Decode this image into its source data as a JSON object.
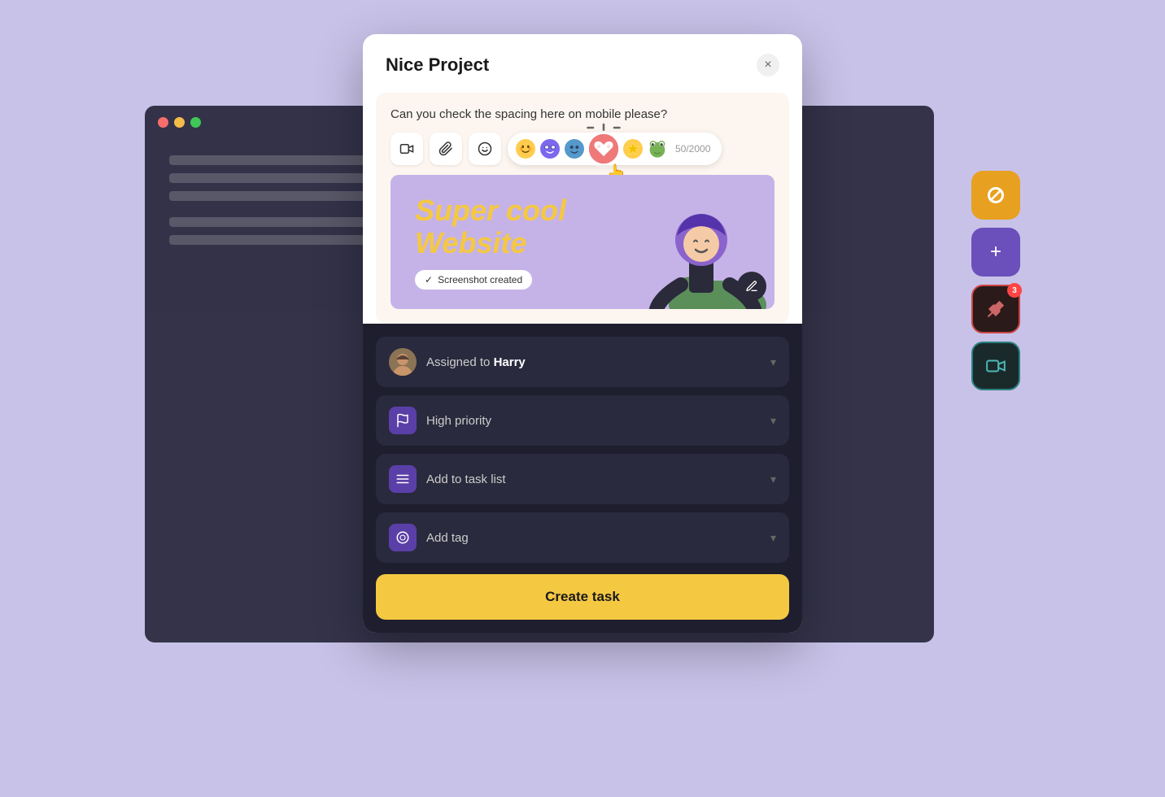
{
  "background": {
    "color": "#c8c2e8"
  },
  "bg_window": {
    "traffic_lights": [
      "red",
      "yellow",
      "green"
    ]
  },
  "right_sidebar": {
    "buttons": [
      {
        "id": "logo",
        "icon": "Q",
        "style": "orange",
        "badge": null
      },
      {
        "id": "add",
        "icon": "+",
        "style": "purple",
        "badge": null
      },
      {
        "id": "pin",
        "icon": "📌",
        "style": "dark-red",
        "badge": "3"
      },
      {
        "id": "video",
        "icon": "🎥",
        "style": "dark-teal",
        "badge": null
      }
    ]
  },
  "modal": {
    "title": "Nice Project",
    "close_label": "×",
    "comment": {
      "text": "Can you check the spacing here on mobile please?",
      "action_buttons": [
        {
          "id": "video-btn",
          "icon": "🎥"
        },
        {
          "id": "attach-btn",
          "icon": "📎"
        },
        {
          "id": "emoji-btn",
          "icon": "😊"
        }
      ],
      "emoji_picker": {
        "emojis": [
          "😊",
          "😈",
          "💙",
          "❤️",
          "⭐",
          "🐸"
        ],
        "active_index": 3
      },
      "char_count": "50/2000"
    },
    "screenshot": {
      "title_line1": "Super cool",
      "title_line2": "Website",
      "badge_text": "Screenshot created",
      "badge_icon": "✓"
    },
    "dropdowns": [
      {
        "id": "assigned-to",
        "type": "avatar",
        "label_prefix": "Assigned to ",
        "label_bold": "Harry",
        "icon_type": "avatar"
      },
      {
        "id": "priority",
        "type": "icon",
        "label": "High priority",
        "icon": "⬛",
        "icon_style": "icon-purple"
      },
      {
        "id": "task-list",
        "type": "icon",
        "label": "Add to task list",
        "icon": "≡",
        "icon_style": "icon-purple"
      },
      {
        "id": "tag",
        "type": "icon",
        "label": "Add tag",
        "icon": "◎",
        "icon_style": "icon-purple"
      }
    ],
    "create_task_button": "Create task"
  }
}
